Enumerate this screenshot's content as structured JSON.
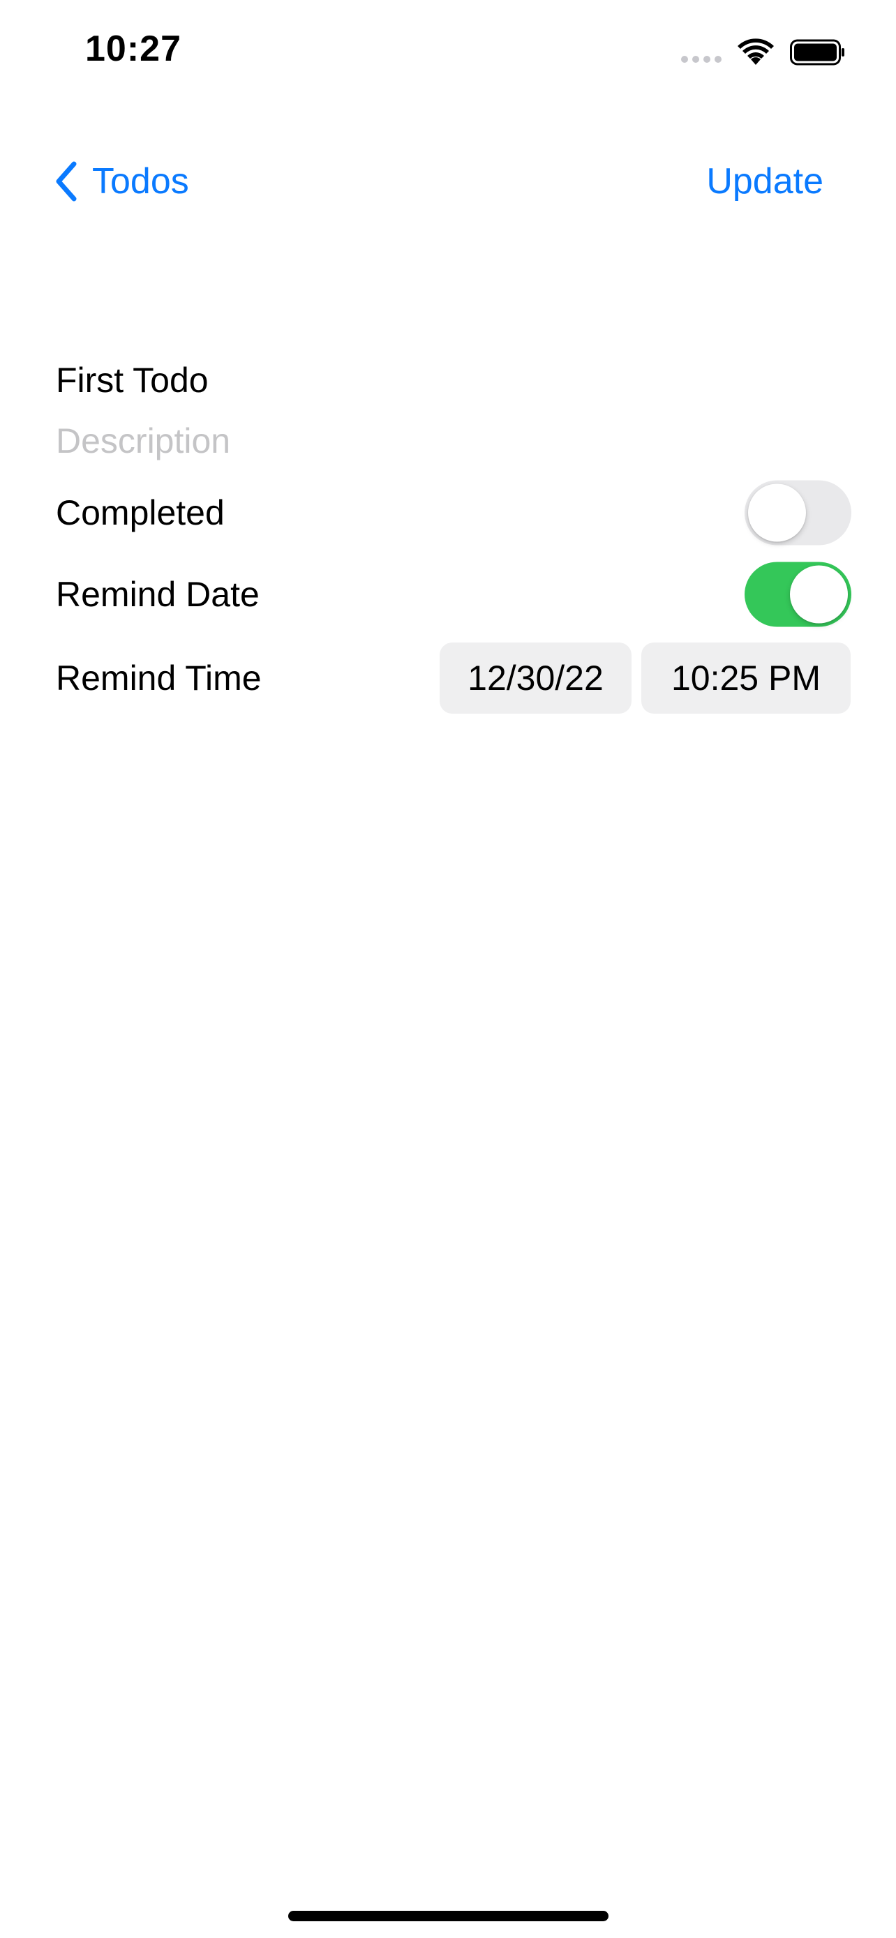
{
  "status_bar": {
    "time": "10:27",
    "icons": [
      "signal-icon",
      "wifi-icon",
      "battery-icon"
    ]
  },
  "nav": {
    "back_label": "Todos",
    "back_icon": "chevron-left-icon",
    "action_label": "Update"
  },
  "form": {
    "title_value": "First Todo",
    "description_value": "",
    "description_placeholder": "Description",
    "completed": {
      "label": "Completed",
      "on": false
    },
    "remind_date": {
      "label": "Remind Date",
      "on": true
    },
    "remind_time": {
      "label": "Remind Time",
      "date": "12/30/22",
      "time": "10:25 PM"
    }
  },
  "colors": {
    "accent": "#0a7aff",
    "toggle_on": "#34c759",
    "toggle_off": "#e9e9eb",
    "picker_bg": "#efeff0",
    "placeholder": "#c4c4c6"
  }
}
